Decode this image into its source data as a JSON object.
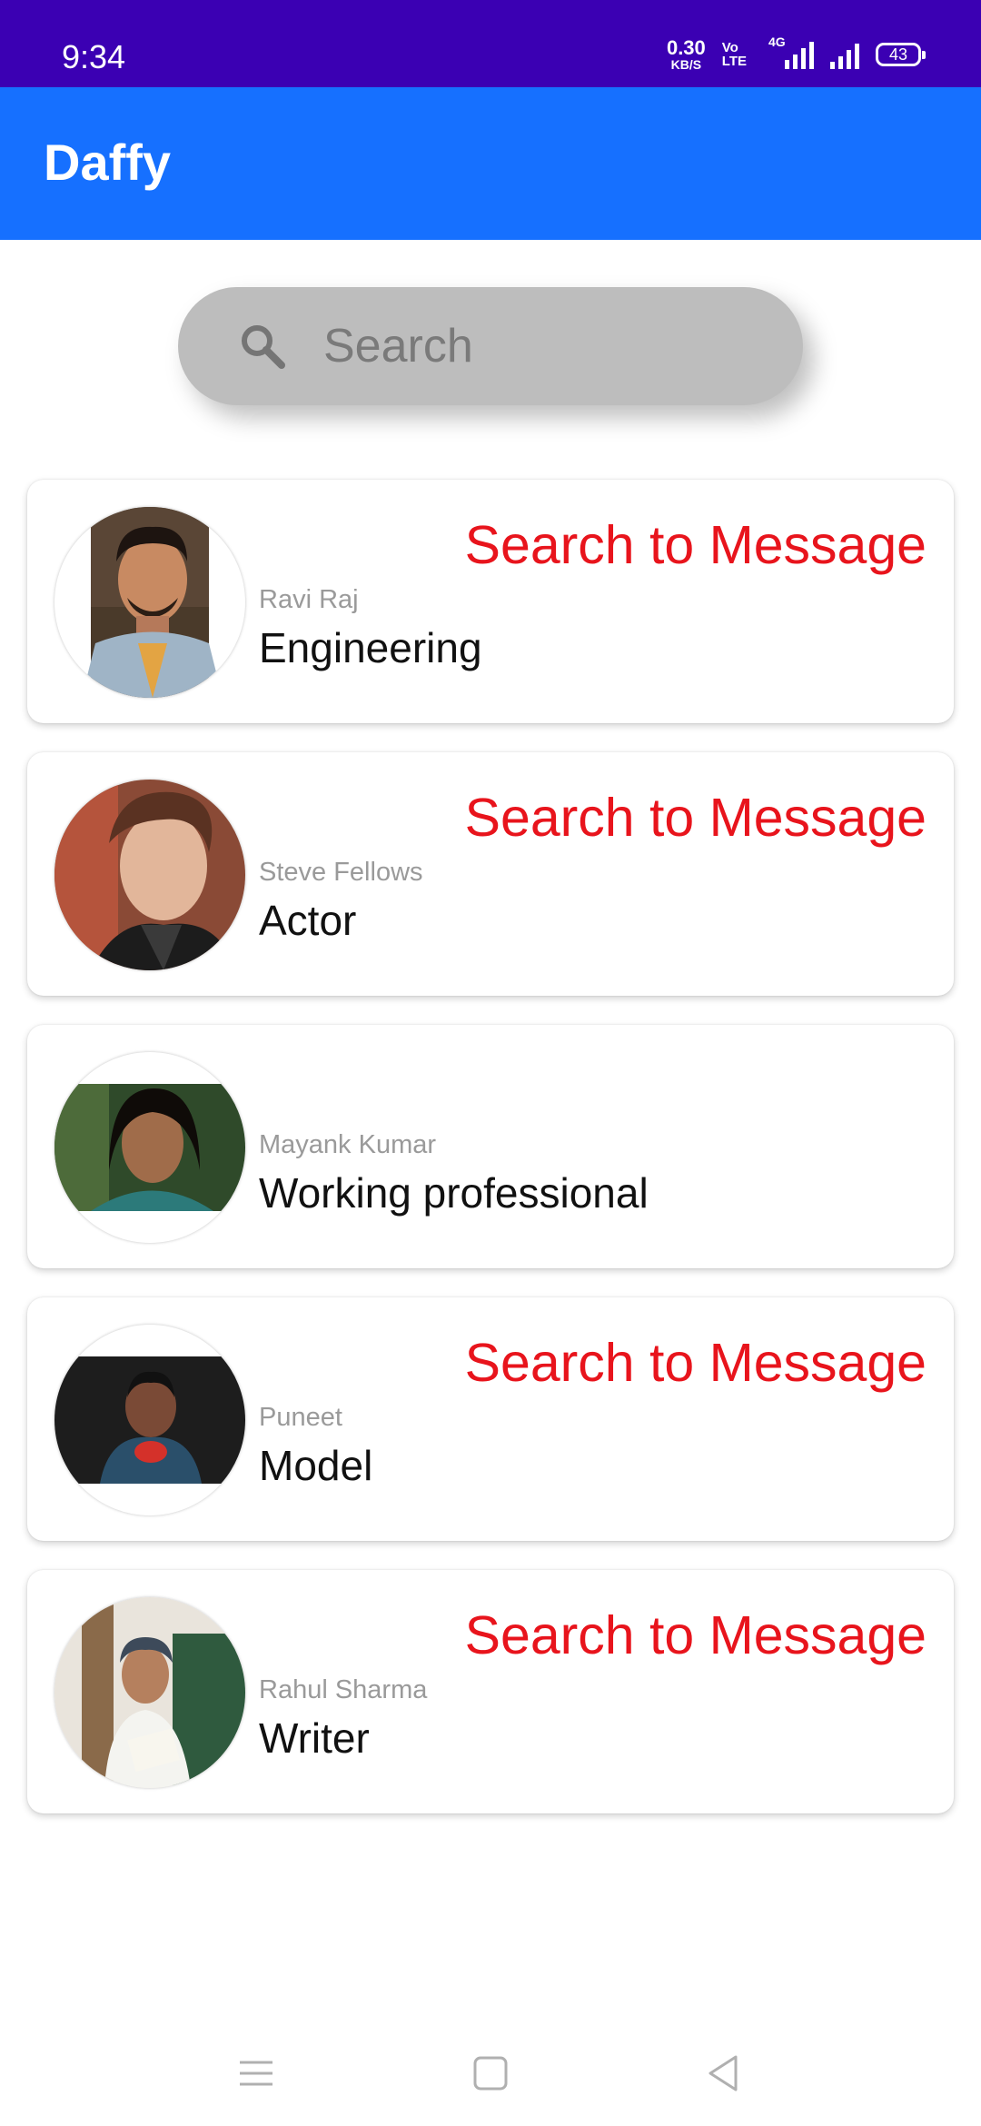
{
  "status_bar": {
    "time": "9:34",
    "net_speed": "0.30",
    "net_unit": "KB/S",
    "volte_top": "Vo",
    "volte_bottom": "LTE",
    "network": "4G",
    "battery": "43"
  },
  "app_bar": {
    "title": "Daffy"
  },
  "search": {
    "placeholder": "Search",
    "icon": "search-icon"
  },
  "contacts": [
    {
      "name": "Ravi Raj",
      "role": "Engineering",
      "cta": "Search to Message"
    },
    {
      "name": "Steve Fellows",
      "role": "Actor",
      "cta": "Search to Message"
    },
    {
      "name": "Mayank Kumar",
      "role": "Working professional",
      "cta": ""
    },
    {
      "name": "Puneet",
      "role": "Model",
      "cta": "Search to Message"
    },
    {
      "name": "Rahul Sharma",
      "role": "Writer",
      "cta": "Search to Message"
    }
  ],
  "colors": {
    "status_bar": "#3b00b3",
    "app_bar": "#1670ff",
    "cta": "#e8141c"
  },
  "nav": {
    "icons": [
      "menu-icon",
      "home-square-icon",
      "back-triangle-icon"
    ]
  }
}
